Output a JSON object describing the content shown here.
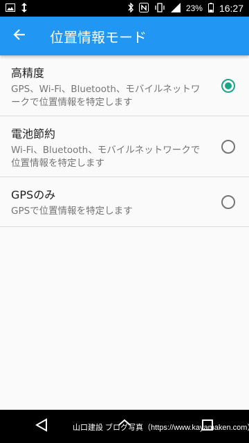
{
  "status_bar": {
    "battery_percent": "23%",
    "time": "16:27"
  },
  "app_bar": {
    "title": "位置情報モード",
    "color": "#2196f3"
  },
  "options": [
    {
      "title": "高精度",
      "subtitle": "GPS、Wi-Fi、Bluetooth、モバイルネットワークで位置情報を特定します",
      "selected": true
    },
    {
      "title": "電池節約",
      "subtitle": "Wi-Fi、Bluetooth、モバイルネットワークで位置情報を特定します",
      "selected": false
    },
    {
      "title": "GPSのみ",
      "subtitle": "GPSで位置情報を特定します",
      "selected": false
    }
  ],
  "accent_color": "#1aa587",
  "watermark": "山口建設 ブログ写真（https://www.kayamaken.com）"
}
